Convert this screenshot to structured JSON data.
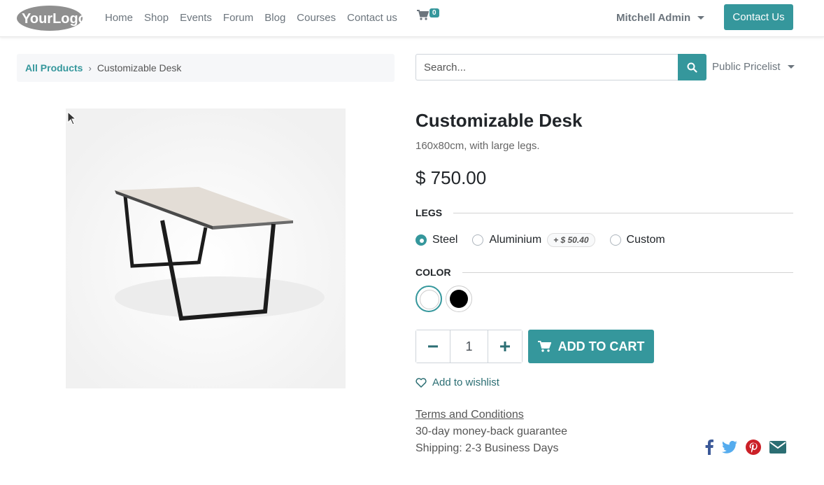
{
  "header": {
    "logo_text": "YourLogo",
    "nav": [
      "Home",
      "Shop",
      "Events",
      "Forum",
      "Blog",
      "Courses",
      "Contact us"
    ],
    "cart_count": "0",
    "user": "Mitchell Admin",
    "contact_button": "Contact Us"
  },
  "breadcrumb": {
    "parent": "All Products",
    "current": "Customizable Desk"
  },
  "search": {
    "placeholder": "Search...",
    "pricelist": "Public Pricelist"
  },
  "product": {
    "name": "Customizable Desk",
    "description": "160x80cm, with large legs.",
    "price": "$ 750.00",
    "attributes": {
      "legs_label": "LEGS",
      "legs_options": [
        {
          "label": "Steel",
          "selected": true
        },
        {
          "label": "Aluminium",
          "extra": "+ $ 50.40",
          "selected": false
        },
        {
          "label": "Custom",
          "selected": false
        }
      ],
      "color_label": "COLOR",
      "colors": [
        "#ffffff",
        "#000000"
      ]
    },
    "quantity": "1",
    "add_to_cart": "ADD TO CART",
    "wishlist": "Add to wishlist",
    "terms": "Terms and Conditions",
    "guarantee": "30-day money-back guarantee",
    "shipping": "Shipping: 2-3 Business Days"
  },
  "colors": {
    "accent": "#35979c",
    "wishlist": "#2b6e73"
  }
}
